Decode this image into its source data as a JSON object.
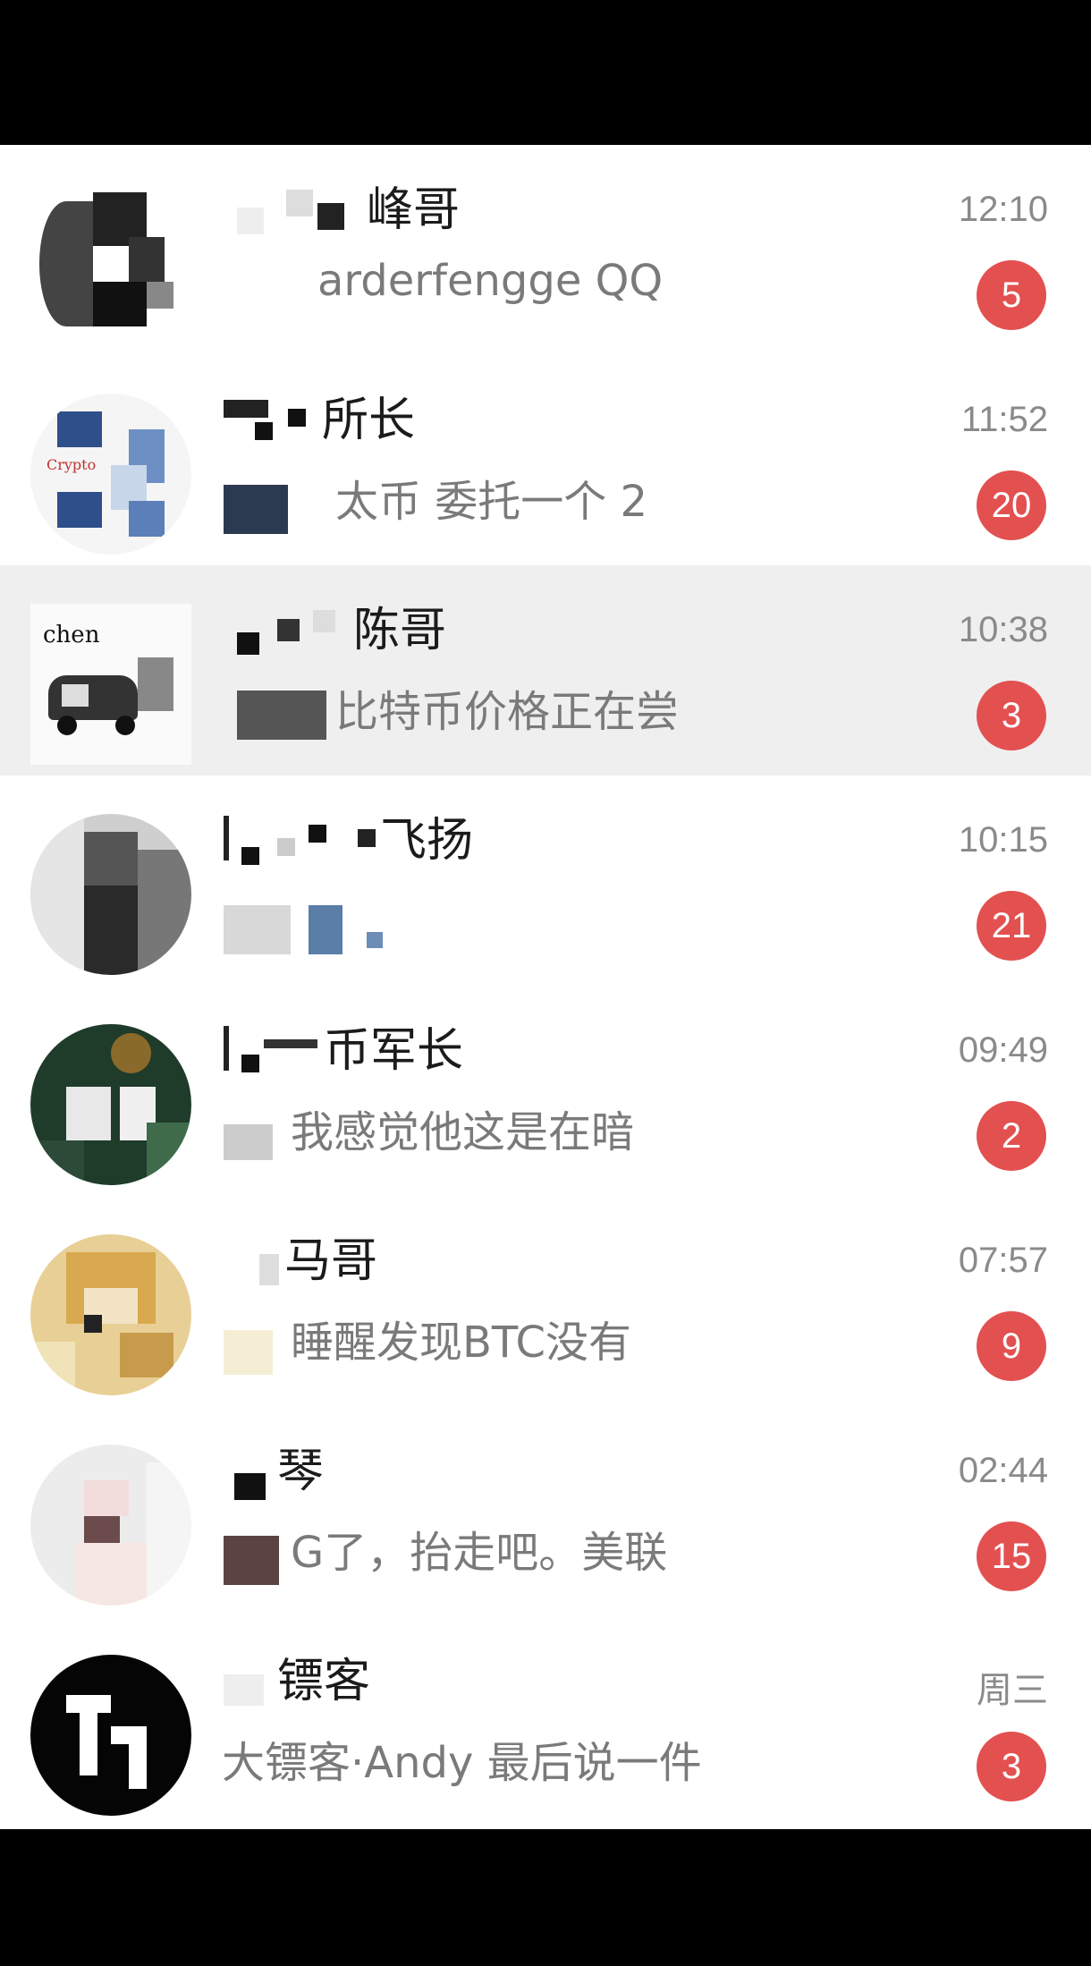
{
  "chats": [
    {
      "name": "峰哥",
      "message": "arderfengge QQ",
      "time": "12:10",
      "unread": "5"
    },
    {
      "name": "所长",
      "message": "太币 委托一个 2",
      "time": "11:52",
      "unread": "20"
    },
    {
      "name": "陈哥",
      "message": "比特币价格正在尝",
      "time": "10:38",
      "unread": "3"
    },
    {
      "name": "飞扬",
      "message": "",
      "time": "10:15",
      "unread": "21"
    },
    {
      "name": "币军长",
      "message": "我感觉他这是在暗",
      "time": "09:49",
      "unread": "2"
    },
    {
      "name": "马哥",
      "message": "睡醒发现BTC没有",
      "time": "07:57",
      "unread": "9"
    },
    {
      "name": "琴",
      "message": "G了，抬走吧。美联",
      "time": "02:44",
      "unread": "15"
    },
    {
      "name": "镖客",
      "message": "大镖客·Andy 最后说一件",
      "time": "周三",
      "unread": "3"
    }
  ],
  "avatar_text": {
    "row2": "Crypto",
    "row3": "chen"
  },
  "colors": {
    "badge": "#e35050",
    "time": "#8a8a8a",
    "name": "#1b1b1b",
    "message": "#7a7a7a"
  }
}
